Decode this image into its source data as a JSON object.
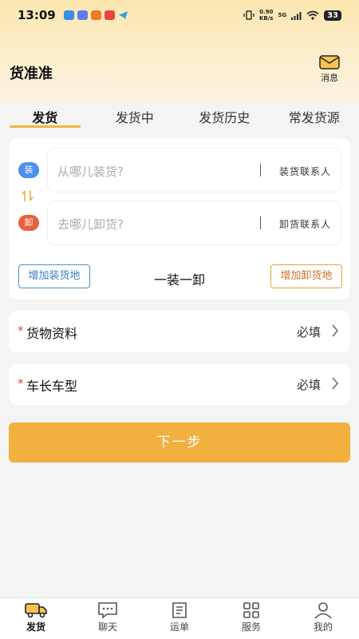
{
  "status": {
    "time": "13:09",
    "net_speed_value": "0.90",
    "net_speed_unit": "KB/s",
    "network": "5G",
    "battery": "33"
  },
  "app": {
    "title": "货准准",
    "messages_label": "消息"
  },
  "tabs": [
    {
      "label": "发货",
      "active": true
    },
    {
      "label": "发货中",
      "active": false
    },
    {
      "label": "发货历史",
      "active": false
    },
    {
      "label": "常发货源",
      "active": false
    }
  ],
  "route": {
    "load_badge": "装",
    "unload_badge": "卸",
    "load_placeholder": "从哪儿装货?",
    "unload_placeholder": "去哪儿卸货?",
    "load_contact": "装货联系人",
    "unload_contact": "卸货联系人",
    "add_load_label": "增加装货地",
    "add_unload_label": "增加卸货地",
    "summary": "一装一卸"
  },
  "form": {
    "goods": {
      "label": "货物资料",
      "value": "必填",
      "required_mark": "*"
    },
    "vehicle": {
      "label": "车长车型",
      "value": "必填",
      "required_mark": "*"
    }
  },
  "next_button": "下一步",
  "nav": [
    {
      "label": "发货",
      "icon": "truck-icon",
      "active": true
    },
    {
      "label": "聊天",
      "icon": "chat-icon",
      "active": false
    },
    {
      "label": "运单",
      "icon": "waybill-icon",
      "active": false
    },
    {
      "label": "服务",
      "icon": "grid-icon",
      "active": false
    },
    {
      "label": "我的",
      "icon": "person-icon",
      "active": false
    }
  ],
  "colors": {
    "accent": "#f2b03f",
    "load": "#4c8ff0",
    "unload": "#e8613f",
    "required": "#e8433f"
  }
}
